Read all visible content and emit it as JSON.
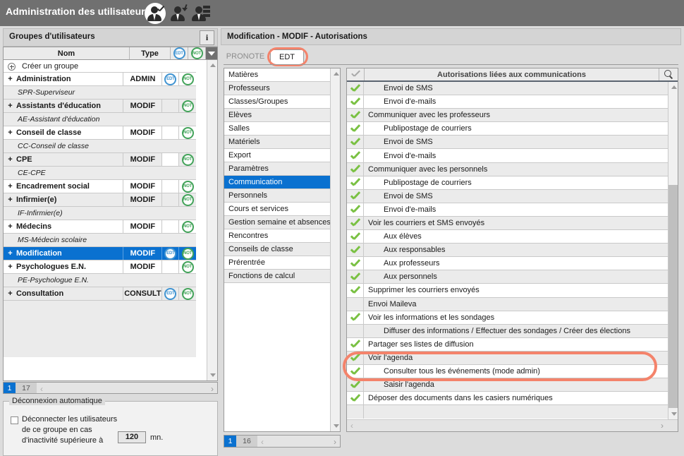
{
  "titlebar": {
    "title": "Administration des utilisateurs",
    "icons": [
      {
        "name": "user-check-icon",
        "active": true
      },
      {
        "name": "user-arrow-icon",
        "active": false
      },
      {
        "name": "user-list-icon",
        "active": false
      }
    ]
  },
  "left_panel": {
    "header_title": "Groupes d'utilisateurs",
    "info_icon": "i",
    "columns": {
      "nom": "Nom",
      "type": "Type",
      "edt": "EDT",
      "not": "NOT"
    },
    "create_row": "Créer un groupe",
    "groups": [
      {
        "name": "Administration",
        "type": "ADMIN",
        "edt": true,
        "not": true,
        "selected": false,
        "sub": "SPR-Superviseur"
      },
      {
        "name": "Assistants d'éducation",
        "type": "MODIF",
        "edt": false,
        "not": true,
        "selected": false,
        "sub": "AE-Assistant d'éducation"
      },
      {
        "name": "Conseil de classe",
        "type": "MODIF",
        "edt": false,
        "not": true,
        "selected": false,
        "sub": "CC-Conseil de classe"
      },
      {
        "name": "CPE",
        "type": "MODIF",
        "edt": false,
        "not": true,
        "selected": false,
        "edt_white": true,
        "sub": "CE-CPE"
      },
      {
        "name": "Encadrement social",
        "type": "MODIF",
        "edt": false,
        "not": true,
        "selected": false,
        "sub": null
      },
      {
        "name": "Infirmier(e)",
        "type": "MODIF",
        "edt": false,
        "not": true,
        "selected": false,
        "sub": "IF-Infirmier(e)"
      },
      {
        "name": "Médecins",
        "type": "MODIF",
        "edt": false,
        "not": true,
        "selected": false,
        "sub": "MS-Médecin scolaire"
      },
      {
        "name": "Modification",
        "type": "MODIF",
        "edt": true,
        "not": true,
        "selected": true,
        "sub": null
      },
      {
        "name": "Psychologues E.N.",
        "type": "MODIF",
        "edt": false,
        "not": true,
        "selected": false,
        "sub": "PE-Psychologue E.N."
      },
      {
        "name": "Consultation",
        "type": "CONSULT",
        "edt": true,
        "not": true,
        "selected": false,
        "sub": null
      }
    ],
    "expand_symbol": "+",
    "pager": {
      "page": "1",
      "total": "17",
      "prev": "‹",
      "next": "›"
    },
    "disconnect": {
      "legend": "Déconnexion automatique",
      "checked": false,
      "line1": "Déconnecter les utilisateurs",
      "line2": "de ce groupe en cas",
      "line3": "d'inactivité supérieure à",
      "minutes": "120",
      "unit": "mn."
    }
  },
  "right_panel": {
    "header_title": "Modification - MODIF - Autorisations",
    "tabs": [
      {
        "label": "PRONOTE",
        "active": false,
        "highlighted": false
      },
      {
        "label": "EDT",
        "active": true,
        "highlighted": true
      }
    ],
    "categories": [
      {
        "label": "Matières",
        "selected": false
      },
      {
        "label": "Professeurs",
        "selected": false
      },
      {
        "label": "Classes/Groupes",
        "selected": false
      },
      {
        "label": "Elèves",
        "selected": false
      },
      {
        "label": "Salles",
        "selected": false
      },
      {
        "label": "Matériels",
        "selected": false
      },
      {
        "label": "Export",
        "selected": false
      },
      {
        "label": "Paramètres",
        "selected": false
      },
      {
        "label": "Communication",
        "selected": true
      },
      {
        "label": "Personnels",
        "selected": false
      },
      {
        "label": "Cours et services",
        "selected": false
      },
      {
        "label": "Gestion semaine et absences",
        "selected": false
      },
      {
        "label": "Rencontres",
        "selected": false
      },
      {
        "label": "Conseils de classe",
        "selected": false
      },
      {
        "label": "Prérentrée",
        "selected": false
      },
      {
        "label": "Fonctions de calcul",
        "selected": false
      }
    ],
    "category_pager": {
      "page": "1",
      "total": "16",
      "prev": "‹",
      "next": "›"
    },
    "permissions_header": "Autorisations liées aux communications",
    "search_icon": "search-icon",
    "permissions": [
      {
        "label": "Envoi de SMS",
        "checked": true,
        "indent": 1,
        "highlighted": false
      },
      {
        "label": "Envoi d'e-mails",
        "checked": true,
        "indent": 1,
        "highlighted": false
      },
      {
        "label": "Communiquer avec les professeurs",
        "checked": true,
        "indent": 0,
        "highlighted": false
      },
      {
        "label": "Publipostage de courriers",
        "checked": true,
        "indent": 1,
        "highlighted": false
      },
      {
        "label": "Envoi de SMS",
        "checked": true,
        "indent": 1,
        "highlighted": false
      },
      {
        "label": "Envoi d'e-mails",
        "checked": true,
        "indent": 1,
        "highlighted": false
      },
      {
        "label": "Communiquer avec les personnels",
        "checked": true,
        "indent": 0,
        "highlighted": false
      },
      {
        "label": "Publipostage de courriers",
        "checked": true,
        "indent": 1,
        "highlighted": false
      },
      {
        "label": "Envoi de SMS",
        "checked": true,
        "indent": 1,
        "highlighted": false
      },
      {
        "label": "Envoi d'e-mails",
        "checked": true,
        "indent": 1,
        "highlighted": false
      },
      {
        "label": "Voir les courriers et SMS envoyés",
        "checked": true,
        "indent": 0,
        "highlighted": false
      },
      {
        "label": "Aux élèves",
        "checked": true,
        "indent": 1,
        "highlighted": false
      },
      {
        "label": "Aux responsables",
        "checked": true,
        "indent": 1,
        "highlighted": false
      },
      {
        "label": "Aux professeurs",
        "checked": true,
        "indent": 1,
        "highlighted": false
      },
      {
        "label": "Aux personnels",
        "checked": true,
        "indent": 1,
        "highlighted": false
      },
      {
        "label": "Supprimer les courriers envoyés",
        "checked": true,
        "indent": 0,
        "highlighted": false
      },
      {
        "label": "Envoi Maileva",
        "checked": false,
        "indent": 0,
        "highlighted": false
      },
      {
        "label": "Voir les informations et les sondages",
        "checked": true,
        "indent": 0,
        "highlighted": false
      },
      {
        "label": "Diffuser des informations / Effectuer des sondages / Créer des élections",
        "checked": false,
        "indent": 1,
        "highlighted": false
      },
      {
        "label": "Partager ses listes de diffusion",
        "checked": true,
        "indent": 0,
        "highlighted": false
      },
      {
        "label": "Voir l'agenda",
        "checked": true,
        "indent": 0,
        "highlighted": true
      },
      {
        "label": "Consulter tous les événements (mode admin)",
        "checked": true,
        "indent": 1,
        "highlighted": true
      },
      {
        "label": "Saisir l'agenda",
        "checked": true,
        "indent": 1,
        "highlighted": false
      },
      {
        "label": "Déposer des documents dans les casiers numériques",
        "checked": true,
        "indent": 0,
        "highlighted": false
      }
    ],
    "hscroll": {
      "prev": "‹",
      "next": "›"
    }
  },
  "colors": {
    "titlebar": "#707070",
    "selection": "#0a71d0",
    "highlight_annotation": "#f4836b",
    "check_green": "#7ac143",
    "badge_edt": "#3f93d1",
    "badge_not": "#43a35a"
  }
}
